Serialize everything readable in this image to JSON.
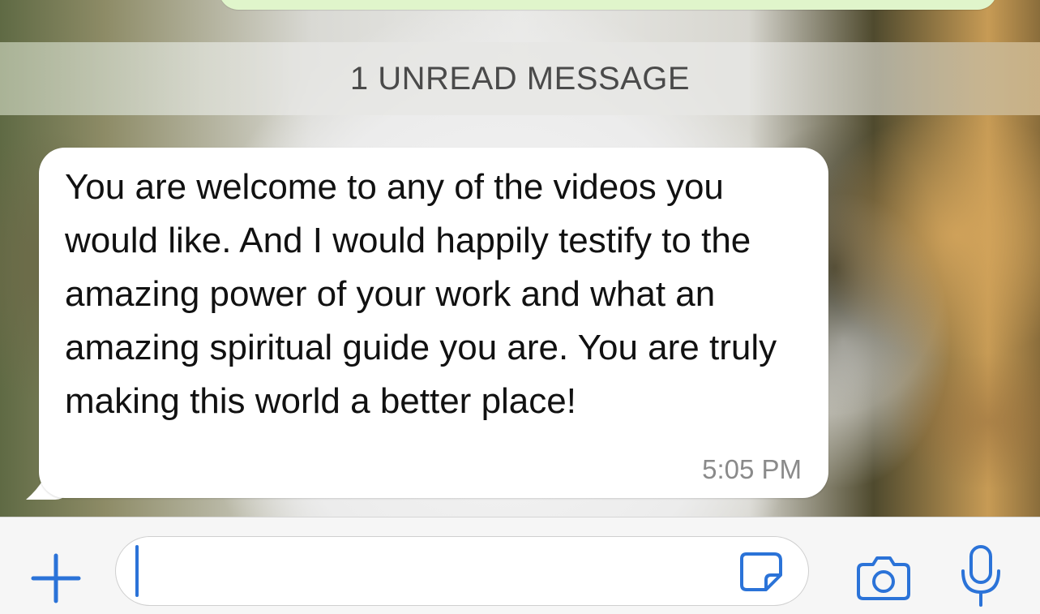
{
  "chat": {
    "unread_banner": "1 UNREAD MESSAGE",
    "message": {
      "text": "You are welcome to any of the videos you would like. And I would happily testify to the amazing power of your work and what an amazing spiritual guide you are. You are truly making this world a better place!",
      "time": "5:05 PM"
    }
  },
  "input_bar": {
    "text_value": "",
    "icons": {
      "attach": "plus-icon",
      "sticker": "sticker-icon",
      "camera": "camera-icon",
      "voice": "microphone-icon"
    }
  },
  "colors": {
    "accent": "#2b73d8",
    "received_bubble": "#ffffff",
    "sent_bubble": "#e0f5cb",
    "banner_text": "#4a4a4a",
    "timestamp": "#8a8a8a"
  }
}
